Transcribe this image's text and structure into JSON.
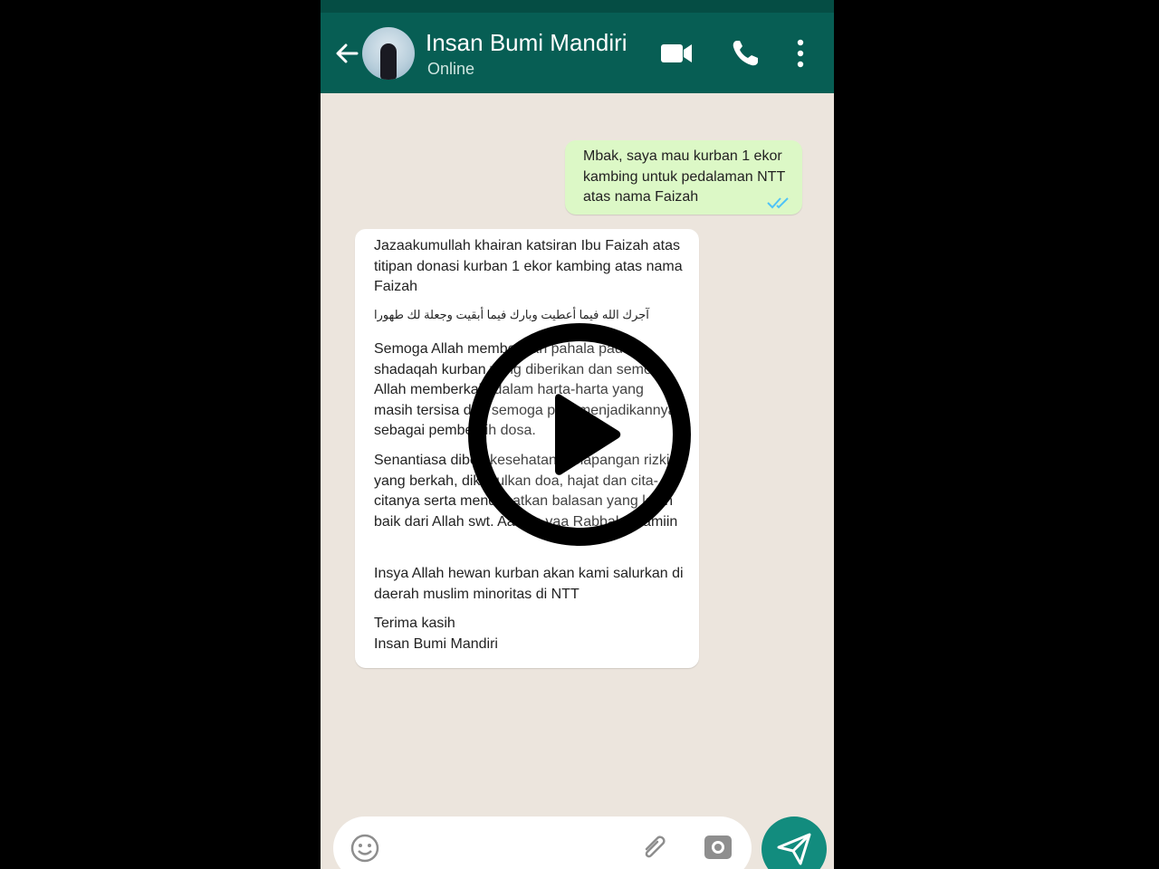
{
  "header": {
    "contact_name": "Insan Bumi Mandiri",
    "contact_status": "Online",
    "icons": [
      "back-arrow-icon",
      "video-call-icon",
      "phone-call-icon",
      "more-vert-icon"
    ]
  },
  "messages": {
    "outgoing": {
      "text": "Mbak, saya mau kurban 1 ekor kambing untuk pedalaman NTT atas nama Faizah"
    },
    "incoming": {
      "p1": "Jazaakumullah khairan katsiran Ibu Faizah atas titipan donasi  kurban 1 ekor kambing atas nama Faizah",
      "p2": "آجرك الله فيما أعطيت وبارك فيما أبقيت وجعلة لك طهورا",
      "p3": "Semoga Allah memberikan pahala pada shadaqah kurban yang diberikan dan semoga Allah memberkahi dalam harta-harta yang masih tersisa dan semoga pula menjadikannya sebagai pembersih dosa.",
      "p4": "Senantiasa diberi kesehatan, kelapangan rizki yang berkah, dikabulkan doa, hajat dan cita-citanya serta mendapatkan balasan yang lebih baik dari Allah swt. Aamiin yaa Rabbal Aalamiin",
      "p5": "Insya Allah hewan kurban akan kami salurkan di daerah muslim minoritas di NTT",
      "p6a": "Terima kasih",
      "p6b": "Insan Bumi Mandiri"
    }
  },
  "composer": {
    "icons": [
      "emoji-icon",
      "attach-icon",
      "camera-icon",
      "send-icon"
    ]
  },
  "overlay": {
    "icon": "play-icon",
    "colors": {
      "ring": "#000000",
      "fill": "#ffffff"
    }
  },
  "colors": {
    "header": "#075e54",
    "chat_bg": "#ece5dd",
    "outgoing_bubble": "#dcf8c6",
    "send_button": "#128c7e"
  }
}
